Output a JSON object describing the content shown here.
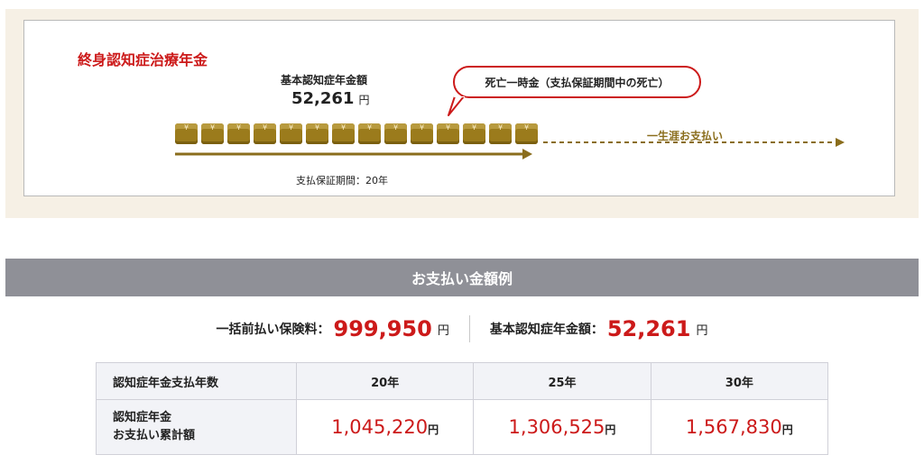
{
  "diagram": {
    "title": "終身認知症治療年金",
    "base_label": "基本認知症年金額",
    "base_amount": "52,261",
    "base_unit": "円",
    "bubble_text": "死亡一時金（支払保証期間中の死亡）",
    "guarantee_period": "支払保証期間：20年",
    "lifetime_text": "一生涯お支払い",
    "coin_count": 14,
    "coin_symbol": "yen-icon",
    "colors": {
      "accent": "#cc1a1a",
      "gold": "#9b7b1c",
      "panel": "#f6f0e5"
    }
  },
  "section": {
    "header": "お支払い金額例",
    "premium_label": "一括前払い保険料：",
    "premium_value": "999,950",
    "premium_unit": "円",
    "base_label": "基本認知症年金額：",
    "base_value": "52,261",
    "base_unit": "円"
  },
  "table": {
    "header_label": "認知症年金支払年数",
    "years": [
      "20年",
      "25年",
      "30年"
    ],
    "row_label_line1": "認知症年金",
    "row_label_line2": "お支払い累計額",
    "amounts": [
      "1,045,220",
      "1,306,525",
      "1,567,830"
    ],
    "unit": "円"
  }
}
